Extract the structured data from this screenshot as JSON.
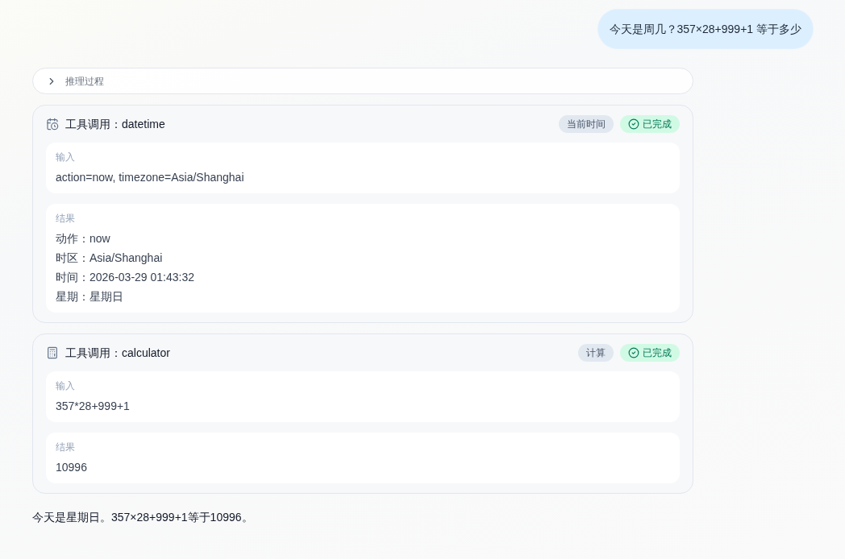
{
  "user_message": {
    "text": "今天是周几？357×28+999+1 等于多少"
  },
  "reasoning": {
    "label": "推理过程",
    "expanded": false
  },
  "tool_calls": [
    {
      "kind": "datetime",
      "title": "工具调用：datetime",
      "tag": "当前时间",
      "status": {
        "kind": "done",
        "label": "已完成"
      },
      "sections": [
        {
          "label": "输入",
          "lines": [
            "action=now, timezone=Asia/Shanghai"
          ]
        },
        {
          "label": "结果",
          "lines": [
            "动作：now",
            "时区：Asia/Shanghai",
            "时间：2026-03-29 01:43:32",
            "星期：星期日"
          ]
        }
      ]
    },
    {
      "kind": "calculator",
      "title": "工具调用：calculator",
      "tag": "计算",
      "status": {
        "kind": "done",
        "label": "已完成"
      },
      "sections": [
        {
          "label": "输入",
          "lines": [
            "357*28+999+1"
          ]
        },
        {
          "label": "结果",
          "lines": [
            "10996"
          ]
        }
      ]
    }
  ],
  "answer": {
    "text": "今天是星期日。357×28+999+1等于10996。"
  }
}
